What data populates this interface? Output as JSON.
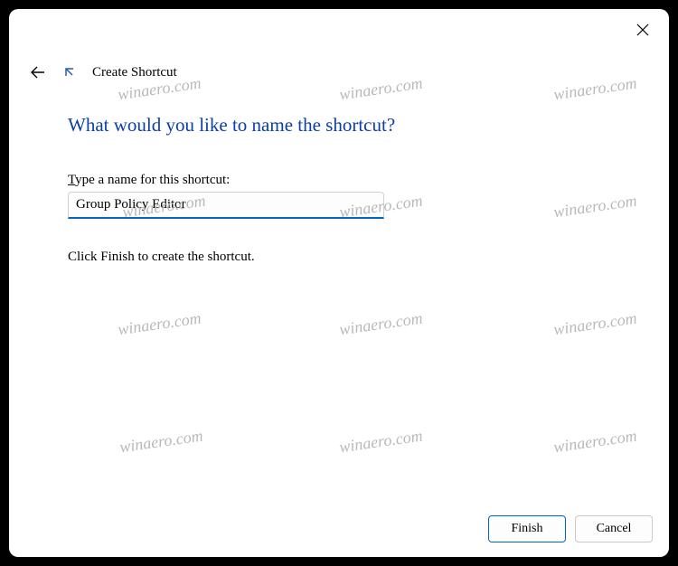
{
  "window": {
    "wizard_title": "Create Shortcut"
  },
  "content": {
    "heading": "What would you like to name the shortcut?",
    "label_prefix": "T",
    "label_rest": "ype a name for this shortcut:",
    "input_value": "Group Policy Editor",
    "instruction": "Click Finish to create the shortcut."
  },
  "footer": {
    "finish": "Finish",
    "cancel": "Cancel"
  },
  "watermark": "winaero.com"
}
